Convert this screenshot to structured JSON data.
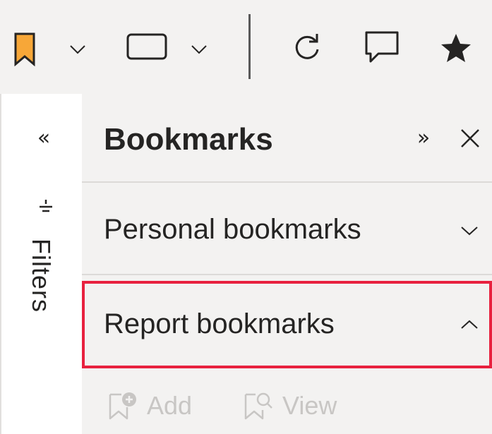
{
  "toolbar": {
    "buttons": [
      {
        "name": "bookmark",
        "icon": "bookmark-icon",
        "color": "#f7a738"
      },
      {
        "name": "view",
        "icon": "rectangle-view-icon"
      },
      {
        "name": "refresh",
        "icon": "refresh-icon"
      },
      {
        "name": "comment",
        "icon": "comment-icon"
      },
      {
        "name": "favorite",
        "icon": "star-icon"
      }
    ]
  },
  "filters": {
    "label": "Filters",
    "expand_glyph": "«"
  },
  "bookmarks_pane": {
    "title": "Bookmarks",
    "collapse_glyph": "»",
    "sections": [
      {
        "label": "Personal bookmarks",
        "expanded": false
      },
      {
        "label": "Report bookmarks",
        "expanded": true
      }
    ],
    "actions": [
      {
        "label": "Add",
        "disabled": true
      },
      {
        "label": "View",
        "disabled": true
      }
    ]
  },
  "colors": {
    "accent_bookmark": "#f7a738",
    "highlight_border": "#e8213f",
    "pane_bg": "#f3f2f1",
    "disabled_text": "#c8c6c4"
  }
}
